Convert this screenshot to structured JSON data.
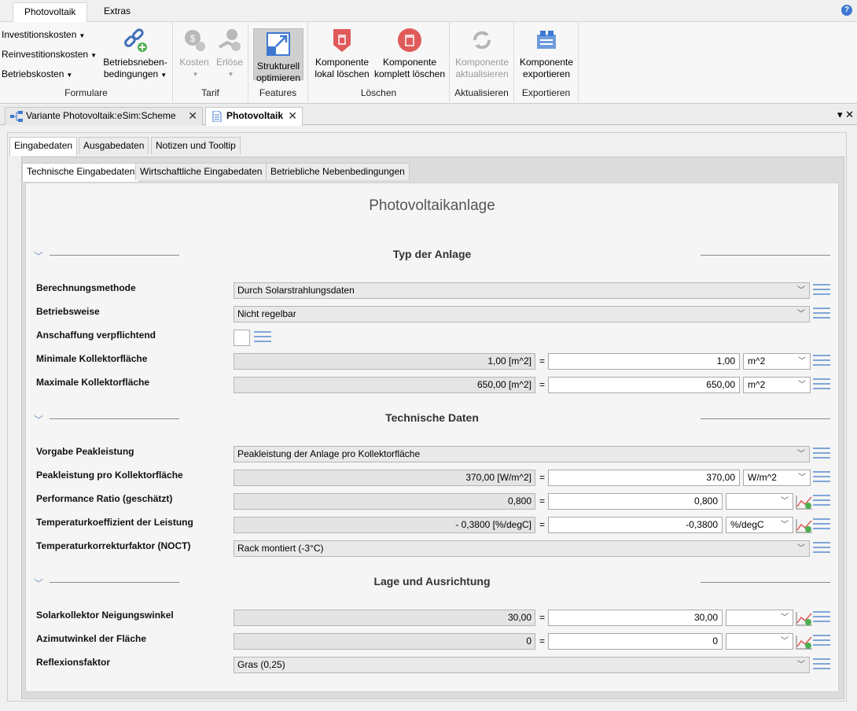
{
  "ribbon_tabs": [
    "Photovoltaik",
    "Extras"
  ],
  "help_label": "?",
  "ribbon": {
    "formulare": {
      "investitionskosten": "Investitionskosten",
      "reinvestitionskosten": "Reinvestitionskosten",
      "betriebskosten": "Betriebskosten",
      "nebenbedingungen_line1": "Betriebsneben-",
      "nebenbedingungen_line2": "bedingungen",
      "label": "Formulare"
    },
    "tarif": {
      "kosten": "Kosten",
      "erloese": "Erlöse",
      "label": "Tarif"
    },
    "features": {
      "line1": "Strukturell",
      "line2": "optimieren",
      "label": "Features"
    },
    "loeschen": {
      "lokal_line1": "Komponente",
      "lokal_line2": "lokal löschen",
      "komplett_line1": "Komponente",
      "komplett_line2": "komplett löschen",
      "label": "Löschen"
    },
    "aktualisieren": {
      "line1": "Komponente",
      "line2": "aktualisieren",
      "label": "Aktualisieren"
    },
    "exportieren": {
      "line1": "Komponente",
      "line2": "exportieren",
      "label": "Exportieren"
    }
  },
  "doc_tabs": [
    "Variante Photovoltaik:eSim:Scheme",
    "Photovoltaik"
  ],
  "tab_controls": {
    "dropdown": "▾",
    "close": "✕"
  },
  "main_tabs": [
    "Eingabedaten",
    "Ausgabedaten",
    "Notizen und Tooltip"
  ],
  "sub_tabs": [
    "Technische Eingabedaten",
    "Wirtschaftliche Eingabedaten",
    "Betriebliche Nebenbedingungen"
  ],
  "form": {
    "title": "Photovoltaikanlage",
    "sections": [
      "Typ der Anlage",
      "Technische Daten",
      "Lage und Ausrichtung"
    ],
    "fields": {
      "berechnungsmethode": {
        "label": "Berechnungsmethode",
        "value": "Durch Solarstrahlungsdaten"
      },
      "betriebsweise": {
        "label": "Betriebsweise",
        "value": "Nicht regelbar"
      },
      "anschaffung": {
        "label": "Anschaffung verpflichtend",
        "checked": false
      },
      "min_flaeche": {
        "label": "Minimale Kollektorfläche",
        "display": "1,00 [m^2]",
        "value": "1,00",
        "unit": "m^2"
      },
      "max_flaeche": {
        "label": "Maximale Kollektorfläche",
        "display": "650,00 [m^2]",
        "value": "650,00",
        "unit": "m^2"
      },
      "vorgabe_peak": {
        "label": "Vorgabe Peakleistung",
        "value": "Peakleistung der Anlage pro Kollektorfläche"
      },
      "peak_pro_flaeche": {
        "label": "Peakleistung pro Kollektorfläche",
        "display": "370,00 [W/m^2]",
        "value": "370,00",
        "unit": "W/m^2"
      },
      "performance_ratio": {
        "label": "Performance Ratio (geschätzt)",
        "display": "0,800",
        "value": "0,800",
        "unit": ""
      },
      "temp_koeff": {
        "label": "Temperaturkoeffizient der Leistung",
        "display": "- 0,3800 [%/degC]",
        "value": "-0,3800",
        "unit": "%/degC"
      },
      "temp_korr": {
        "label": "Temperaturkorrekturfaktor (NOCT)",
        "value": "Rack montiert (-3°C)"
      },
      "neigung": {
        "label": "Solarkollektor Neigungswinkel",
        "display": "30,00",
        "value": "30,00",
        "unit": ""
      },
      "azimut": {
        "label": "Azimutwinkel der Fläche",
        "display": "0",
        "value": "0",
        "unit": ""
      },
      "reflexion": {
        "label": "Reflexionsfaktor",
        "value": "Gras (0,25)"
      }
    },
    "equals": "="
  },
  "colors": {
    "accent": "#3e78d0",
    "menu_icon": "#7fa6d8",
    "delete_red": "#e05a5a"
  }
}
